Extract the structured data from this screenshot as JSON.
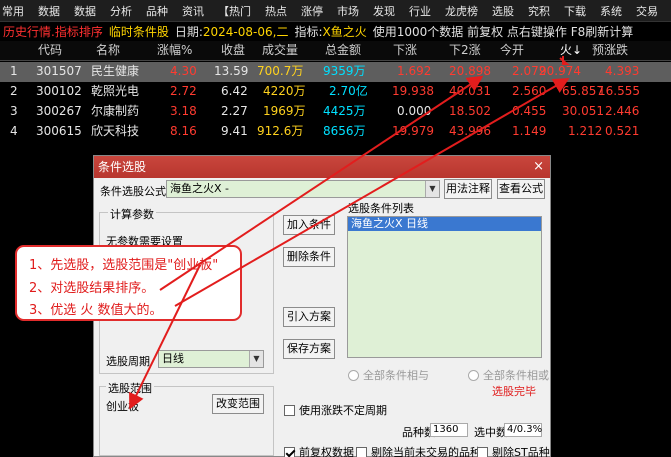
{
  "menu": [
    "常用",
    "数据",
    "数据",
    "分析",
    "品种",
    "资讯",
    "【热门",
    "热点",
    "涨停",
    "市场",
    "发现",
    "行业",
    "龙虎榜",
    "选股",
    "究积",
    "下载",
    "系统",
    "交易"
  ],
  "status": {
    "mode": "历史行情.指标排序",
    "cond": "临时条件股",
    "date_label": "日期:",
    "date": "2024-08-06,二",
    "ind_label": "指标:",
    "ind": "X鱼之火",
    "tail": "使用1000个数据 前复权 点右键操作 F8刷新计算"
  },
  "table": {
    "headers": [
      "代码",
      "名称",
      "涨幅%",
      "收盘",
      "成交量",
      "总金额",
      "下涨",
      "下2涨",
      "今开",
      "火↓",
      "预涨跌"
    ],
    "rows": [
      {
        "n": "1",
        "code": "301507",
        "name": "民生健康",
        "chg": "4.30",
        "close": "13.59",
        "vol": "700.7万",
        "amt": "9359万",
        "x1": "1.692",
        "x2": "20.898",
        "open": "2.072",
        "fire": "90.974",
        "pred": "4.393"
      },
      {
        "n": "2",
        "code": "300102",
        "name": "乾照光电",
        "chg": "2.72",
        "close": "6.42",
        "vol": "4220万",
        "amt": "2.70亿",
        "x1": "19.938",
        "x2": "40.031",
        "open": "2.560",
        "fire": "65.857",
        "pred": "16.555"
      },
      {
        "n": "3",
        "code": "300267",
        "name": "尔康制药",
        "chg": "3.18",
        "close": "2.27",
        "vol": "1969万",
        "amt": "4425万",
        "x1": "0.000",
        "x2": "18.502",
        "open": "0.455",
        "fire": "30.051",
        "pred": "2.446"
      },
      {
        "n": "4",
        "code": "300615",
        "name": "欣天科技",
        "chg": "8.16",
        "close": "9.41",
        "vol": "912.6万",
        "amt": "8656万",
        "x1": "19.979",
        "x2": "43.996",
        "open": "1.149",
        "fire": "1.212",
        "pred": "0.521"
      }
    ]
  },
  "dialog": {
    "title": "条件选股",
    "close": "×",
    "formula_label": "条件选股公式",
    "formula_value": "海鱼之火X    -",
    "help_btn": "用法注释",
    "view_btn": "查看公式",
    "params_group": "计算参数",
    "params_text": "无参数需要设置",
    "add_btn": "加入条件",
    "del_btn": "删除条件",
    "import_btn": "引入方案",
    "save_btn": "保存方案",
    "list_label": "选股条件列表",
    "list_item": "海鱼之火X    日线",
    "period_label": "选股周期",
    "period_value": "日线",
    "range_group": "选股范围",
    "range_value": "创业板",
    "change_range_btn": "改变范围",
    "radio_and": "全部条件相与",
    "radio_or": "全部条件相或",
    "done": "选股完毕",
    "use_period_chk": "使用涨跌不定周期",
    "count_label": "品种数",
    "count_value": "1360",
    "picked_label": "选中数",
    "picked_value": "4/0.3%",
    "chk_fq": "前复权数据",
    "chk_excl_notrade": "剔除当前未交易的品种",
    "chk_excl_st": "剔除ST品种"
  },
  "annotation": {
    "l1": "1、先选股，选股范围是\"创业板\"",
    "l2": "2、对选股结果排序。",
    "l3": "3、优选 火 数值大的。"
  },
  "colors": {
    "red": "#ff3b30",
    "yellow": "#ffd21e",
    "cyan": "#00e0ff",
    "green": "#2fdc2f",
    "title_bar": "#c13f36"
  }
}
